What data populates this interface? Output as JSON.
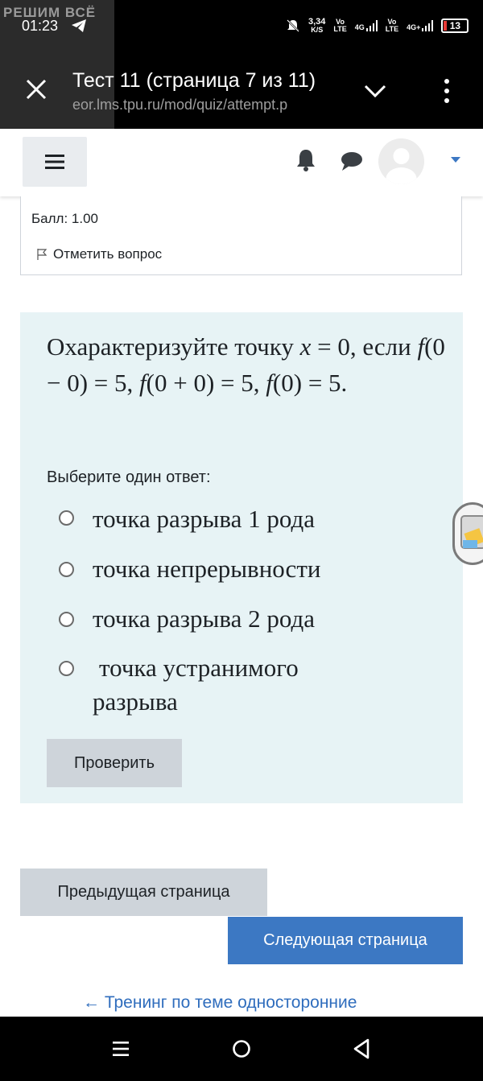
{
  "status_bar": {
    "watermark": "РЕШИМ ВСЁ",
    "time": "01:23",
    "net_speed": "3,34",
    "net_speed_unit": "K/S",
    "sim1_top": "Vo",
    "sim1_bottom": "LTE",
    "sim1_net": "4G",
    "sim2_top": "Vo",
    "sim2_bottom": "LTE",
    "sim2_net": "4G+",
    "battery": "13",
    "battery_color": "#e53935"
  },
  "browser": {
    "title": "Тест 11 (страница 7 из 11)",
    "url": "eor.lms.tpu.ru/mod/quiz/attempt.p"
  },
  "navbar": {
    "icons": [
      "menu-icon",
      "bell-icon",
      "chat-icon",
      "avatar",
      "caret-down-icon"
    ]
  },
  "info": {
    "grade": "Балл: 1.00",
    "flag_label": "Отметить вопрос"
  },
  "question": {
    "text_parts": {
      "t1": "Охарактеризуйте точку ",
      "x": "x",
      "t2": " = 0, если ",
      "f1": "f",
      "t3": "(0 − 0) = 5, ",
      "f2": "f",
      "t4": "(0 + 0) = 5, ",
      "f3": "f",
      "t5": "(0) = 5."
    },
    "prompt": "Выберите один ответ:",
    "options": [
      {
        "label": "точка разрыва 1 рода"
      },
      {
        "label": "точка непрерывности"
      },
      {
        "label": "точка разрыва 2 рода"
      },
      {
        "label": "точка устранимого",
        "label2": "разрыва"
      }
    ],
    "check_button": "Проверить",
    "background": "#e7f3f5"
  },
  "navigation": {
    "prev": "Предыдущая страница",
    "next": "Следующая страница",
    "link": "← Тренинг по теме односторонние",
    "accent": "#3c78c3"
  }
}
